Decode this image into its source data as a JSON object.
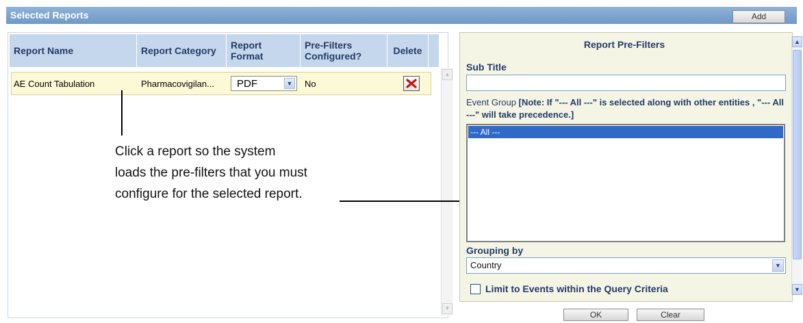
{
  "header": {
    "title": "Selected Reports",
    "add_label": "Add"
  },
  "grid": {
    "columns": [
      "Report Name",
      "Report Category",
      "Report Format",
      "Pre-Filters Configured?",
      "Delete"
    ],
    "rows": [
      {
        "name": "AE Count Tabulation",
        "category": "Pharmacovigilan...",
        "format": "PDF",
        "prefilters": "No"
      }
    ]
  },
  "callout": {
    "lines": [
      "Click a report so the system",
      "loads the pre-filters that you must",
      "configure for the selected report."
    ]
  },
  "prefilters": {
    "title": "Report Pre-Filters",
    "subtitle_label": "Sub Title",
    "subtitle_value": "",
    "event_group_label": "Event Group",
    "event_group_note": "[Note: If \"--- All ---\" is selected along with other entities , \"--- All ---\" will take precedence.]",
    "event_group_options": [
      "--- All ---"
    ],
    "grouping_label": "Grouping by",
    "grouping_value": "Country",
    "limit_label": "Limit to Events within the Query Criteria",
    "limit_checked": false
  },
  "footer": {
    "ok_label": "OK",
    "clear_label": "Clear"
  },
  "colors": {
    "header_blue": "#6f98c6",
    "grid_header": "#c5d7ec",
    "row_highlight": "#fcf9d6",
    "label_navy": "#243a66",
    "selection_blue": "#3169c6",
    "delete_red": "#cc1111"
  }
}
